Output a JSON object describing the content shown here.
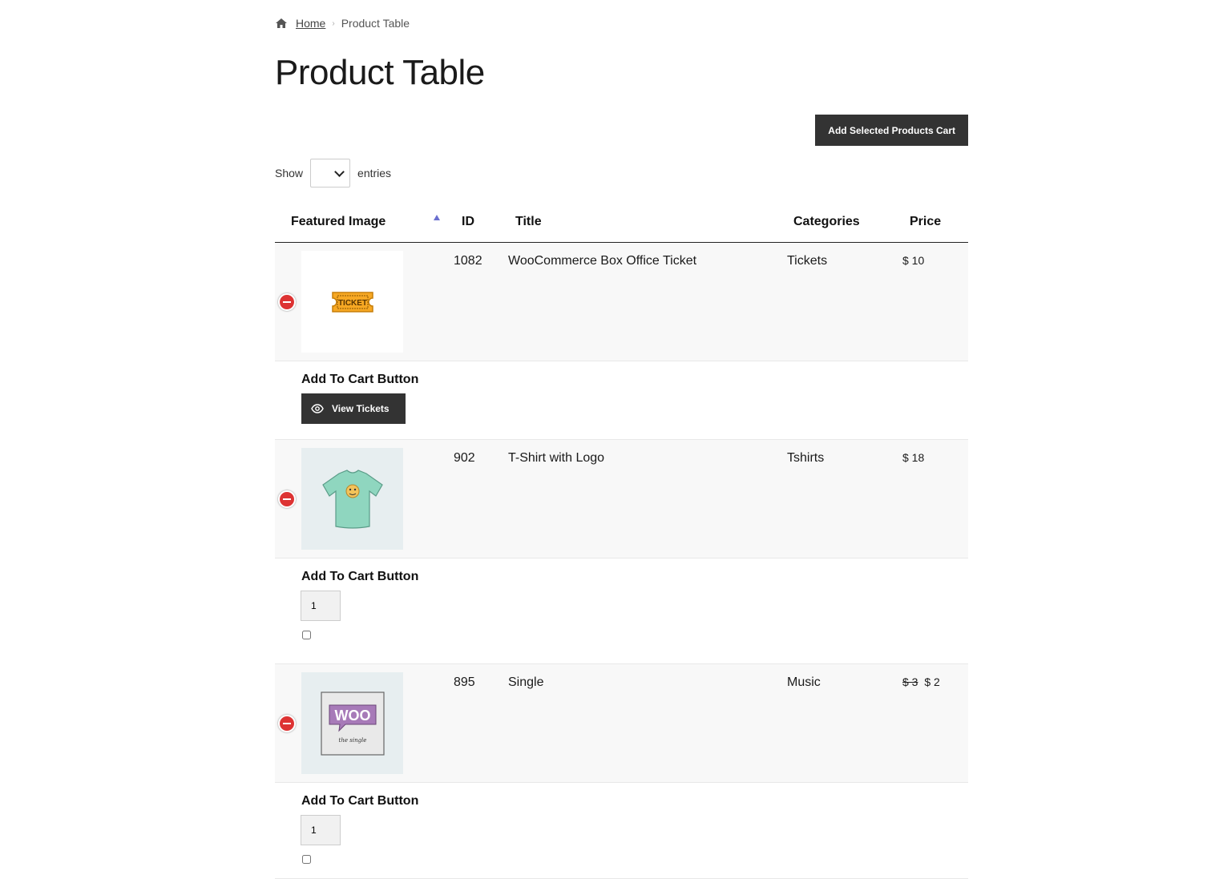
{
  "breadcrumb": {
    "home_label": "Home",
    "current": "Product Table"
  },
  "page_title": "Product Table",
  "toolbar": {
    "add_selected_label": "Add Selected Products Cart"
  },
  "show_entries": {
    "prefix": "Show",
    "value": "",
    "suffix": "entries"
  },
  "table": {
    "headers": {
      "featured_image": "Featured Image",
      "id": "ID",
      "title": "Title",
      "categories": "Categories",
      "price": "Price"
    },
    "sort": {
      "column": "featured_image",
      "direction": "ascending"
    },
    "rows": [
      {
        "id": "1082",
        "title": "WooCommerce Box Office Ticket",
        "category": "Tickets",
        "price": "$ 10",
        "price_old": "",
        "image_icon": "ticket-image",
        "image_text": "TICKET",
        "detail_label": "Add To Cart Button",
        "action_label": "View Tickets"
      },
      {
        "id": "902",
        "title": "T-Shirt with Logo",
        "category": "Tshirts",
        "price": "$ 18",
        "price_old": "",
        "image_icon": "tshirt-image",
        "detail_label": "Add To Cart Button",
        "qty": "1"
      },
      {
        "id": "895",
        "title": "Single",
        "category": "Music",
        "price": "$ 2",
        "price_old": "$ 3",
        "image_icon": "woo-single-image",
        "image_text": "WOO",
        "image_subtext": "the single",
        "detail_label": "Add To Cart Button",
        "qty": "1"
      }
    ]
  },
  "colors": {
    "button_bg": "#333333",
    "remove_icon": "#dd3333",
    "row_bg": "#f8f8f8",
    "sort_arrow": "#6a6fcf"
  }
}
